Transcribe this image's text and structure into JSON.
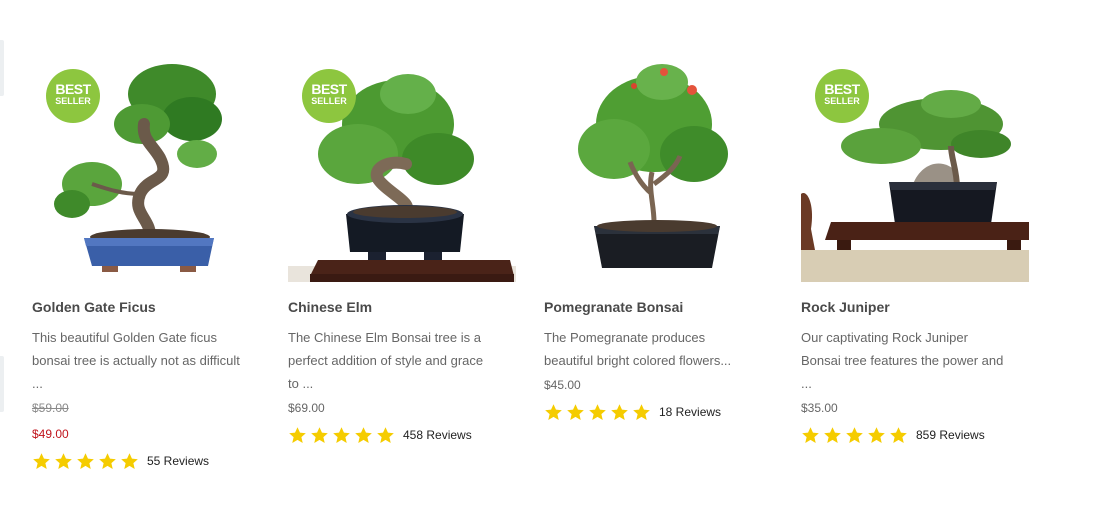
{
  "badge": {
    "line1": "BEST",
    "line2": "SELLER"
  },
  "products": [
    {
      "name": "Golden Gate Ficus",
      "description_lines": [
        "This beautiful Golden Gate ficus",
        "bonsai tree is actually not as difficult",
        "..."
      ],
      "old_price": "$59.00",
      "price": "$49.00",
      "rating": 5,
      "reviews": "55 Reviews",
      "best_seller": true
    },
    {
      "name": "Chinese Elm",
      "description_lines": [
        "The Chinese Elm Bonsai tree is a",
        "perfect addition of style and grace",
        "to ..."
      ],
      "price": "$69.00",
      "rating": 5,
      "reviews": "458 Reviews",
      "best_seller": true
    },
    {
      "name": "Pomegranate Bonsai",
      "description_lines": [
        "The Pomegranate produces",
        "beautiful bright colored flowers..."
      ],
      "price": "$45.00",
      "rating": 5,
      "reviews": "18 Reviews",
      "best_seller": false
    },
    {
      "name": "Rock Juniper",
      "description_lines": [
        "Our captivating Rock Juniper",
        "Bonsai tree features the power and",
        "..."
      ],
      "price": "$35.00",
      "rating": 5,
      "reviews": "859 Reviews",
      "best_seller": true
    }
  ],
  "colors": {
    "badge": "#8dc63f",
    "star": "#f5cc00",
    "sale_price": "#c0141c"
  }
}
